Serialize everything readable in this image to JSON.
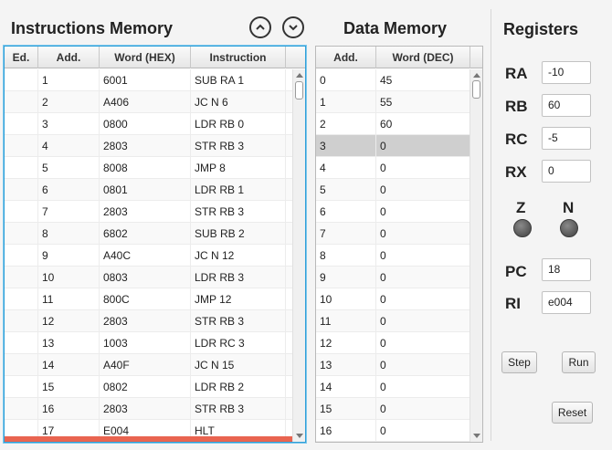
{
  "instructions_memory": {
    "title": "Instructions Memory",
    "columns": [
      "Ed.",
      "Add.",
      "Word (HEX)",
      "Instruction"
    ],
    "rows": [
      {
        "ed": "",
        "add": "1",
        "word": "6001",
        "instr": "SUB RA 1"
      },
      {
        "ed": "",
        "add": "2",
        "word": "A406",
        "instr": "JC N 6"
      },
      {
        "ed": "",
        "add": "3",
        "word": "0800",
        "instr": "LDR RB 0"
      },
      {
        "ed": "",
        "add": "4",
        "word": "2803",
        "instr": "STR RB 3"
      },
      {
        "ed": "",
        "add": "5",
        "word": "8008",
        "instr": "JMP 8"
      },
      {
        "ed": "",
        "add": "6",
        "word": "0801",
        "instr": "LDR RB 1"
      },
      {
        "ed": "",
        "add": "7",
        "word": "2803",
        "instr": "STR RB 3"
      },
      {
        "ed": "",
        "add": "8",
        "word": "6802",
        "instr": "SUB RB 2"
      },
      {
        "ed": "",
        "add": "9",
        "word": "A40C",
        "instr": "JC N 12"
      },
      {
        "ed": "",
        "add": "10",
        "word": "0803",
        "instr": "LDR RB 3"
      },
      {
        "ed": "",
        "add": "11",
        "word": "800C",
        "instr": "JMP 12"
      },
      {
        "ed": "",
        "add": "12",
        "word": "2803",
        "instr": "STR RB 3"
      },
      {
        "ed": "",
        "add": "13",
        "word": "1003",
        "instr": "LDR RC 3"
      },
      {
        "ed": "",
        "add": "14",
        "word": "A40F",
        "instr": "JC N 15"
      },
      {
        "ed": "",
        "add": "15",
        "word": "0802",
        "instr": "LDR RB 2"
      },
      {
        "ed": "",
        "add": "16",
        "word": "2803",
        "instr": "STR RB 3"
      },
      {
        "ed": "",
        "add": "17",
        "word": "E004",
        "instr": "HLT"
      }
    ],
    "highlight_color": "#e96450"
  },
  "nav": {
    "up_icon": "chevron-up-circle-icon",
    "down_icon": "chevron-down-circle-icon"
  },
  "data_memory": {
    "title": "Data Memory",
    "columns": [
      "Add.",
      "Word (DEC)"
    ],
    "rows": [
      {
        "add": "0",
        "word": "45"
      },
      {
        "add": "1",
        "word": "55"
      },
      {
        "add": "2",
        "word": "60"
      },
      {
        "add": "3",
        "word": "0"
      },
      {
        "add": "4",
        "word": "0"
      },
      {
        "add": "5",
        "word": "0"
      },
      {
        "add": "6",
        "word": "0"
      },
      {
        "add": "7",
        "word": "0"
      },
      {
        "add": "8",
        "word": "0"
      },
      {
        "add": "9",
        "word": "0"
      },
      {
        "add": "10",
        "word": "0"
      },
      {
        "add": "11",
        "word": "0"
      },
      {
        "add": "12",
        "word": "0"
      },
      {
        "add": "13",
        "word": "0"
      },
      {
        "add": "14",
        "word": "0"
      },
      {
        "add": "15",
        "word": "0"
      },
      {
        "add": "16",
        "word": "0"
      }
    ],
    "selected_row": 3
  },
  "registers": {
    "title": "Registers",
    "RA": {
      "label": "RA",
      "value": "-10"
    },
    "RB": {
      "label": "RB",
      "value": "60"
    },
    "RC": {
      "label": "RC",
      "value": "-5"
    },
    "RX": {
      "label": "RX",
      "value": "0"
    },
    "Z": {
      "label": "Z"
    },
    "N": {
      "label": "N"
    },
    "PC": {
      "label": "PC",
      "value": "18"
    },
    "RI": {
      "label": "RI",
      "value": "e004"
    }
  },
  "buttons": {
    "step": "Step",
    "run": "Run",
    "reset": "Reset"
  }
}
